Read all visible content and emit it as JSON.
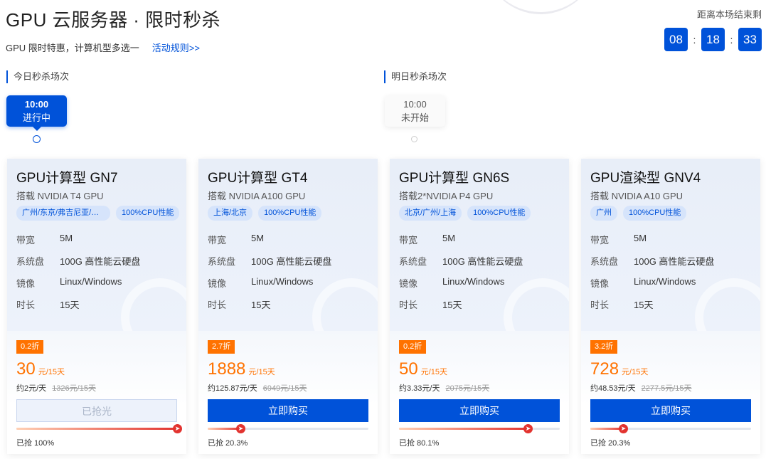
{
  "header": {
    "title": "GPU 云服务器 · 限时秒杀",
    "subtitle": "GPU 限时特惠，计算机型多选一",
    "rules_link": "活动规则>>"
  },
  "countdown": {
    "label": "距离本场结束剩",
    "hours": "08",
    "minutes": "18",
    "seconds": "33",
    "separator": ":"
  },
  "sessions": {
    "today": {
      "label": "今日秒杀场次",
      "slot_time": "10:00",
      "slot_status": "进行中"
    },
    "tomorrow": {
      "label": "明日秒杀场次",
      "slot_time": "10:00",
      "slot_status": "未开始"
    }
  },
  "spec_labels": {
    "bandwidth": "带宽",
    "disk": "系统盘",
    "image": "镜像",
    "duration": "时长"
  },
  "products": [
    {
      "name": "GPU计算型 GN7",
      "desc": "搭载 NVIDIA T4 GPU",
      "region_tag": "广州/东京/弗吉尼亚/曼…",
      "perf_tag": "100%CPU性能",
      "bandwidth": "5M",
      "disk": "100G 高性能云硬盘",
      "image": "Linux/Windows",
      "duration": "15天",
      "discount": "0.2折",
      "price": "30",
      "price_unit": "元/15天",
      "per_day": "约2元/天",
      "original_price": "1326元/15天",
      "button": "已抢光",
      "sold_out": true,
      "progress": 1.0,
      "grabbed": "已抢 100%"
    },
    {
      "name": "GPU计算型 GT4",
      "desc": "搭载 NVIDIA A100 GPU",
      "region_tag": "上海/北京",
      "perf_tag": "100%CPU性能",
      "bandwidth": "5M",
      "disk": "100G 高性能云硬盘",
      "image": "Linux/Windows",
      "duration": "15天",
      "discount": "2.7折",
      "price": "1888",
      "price_unit": "元/15天",
      "per_day": "约125.87元/天",
      "original_price": "6949元/15天",
      "button": "立即购买",
      "sold_out": false,
      "progress": 0.203,
      "grabbed": "已抢 20.3%"
    },
    {
      "name": "GPU计算型 GN6S",
      "desc": "搭载2*NVIDIA P4 GPU",
      "region_tag": "北京/广州/上海",
      "perf_tag": "100%CPU性能",
      "bandwidth": "5M",
      "disk": "100G 高性能云硬盘",
      "image": "Linux/Windows",
      "duration": "15天",
      "discount": "0.2折",
      "price": "50",
      "price_unit": "元/15天",
      "per_day": "约3.33元/天",
      "original_price": "2075元/15天",
      "button": "立即购买",
      "sold_out": false,
      "progress": 0.801,
      "grabbed": "已抢 80.1%"
    },
    {
      "name": "GPU渲染型 GNV4",
      "desc": "搭载 NVIDIA A10 GPU",
      "region_tag": "广州",
      "perf_tag": "100%CPU性能",
      "bandwidth": "5M",
      "disk": "100G 高性能云硬盘",
      "image": "Linux/Windows",
      "duration": "15天",
      "discount": "3.2折",
      "price": "728",
      "price_unit": "元/15天",
      "per_day": "约48.53元/天",
      "original_price": "2277.5元/15天",
      "button": "立即购买",
      "sold_out": false,
      "progress": 0.203,
      "grabbed": "已抢 20.3%"
    }
  ]
}
